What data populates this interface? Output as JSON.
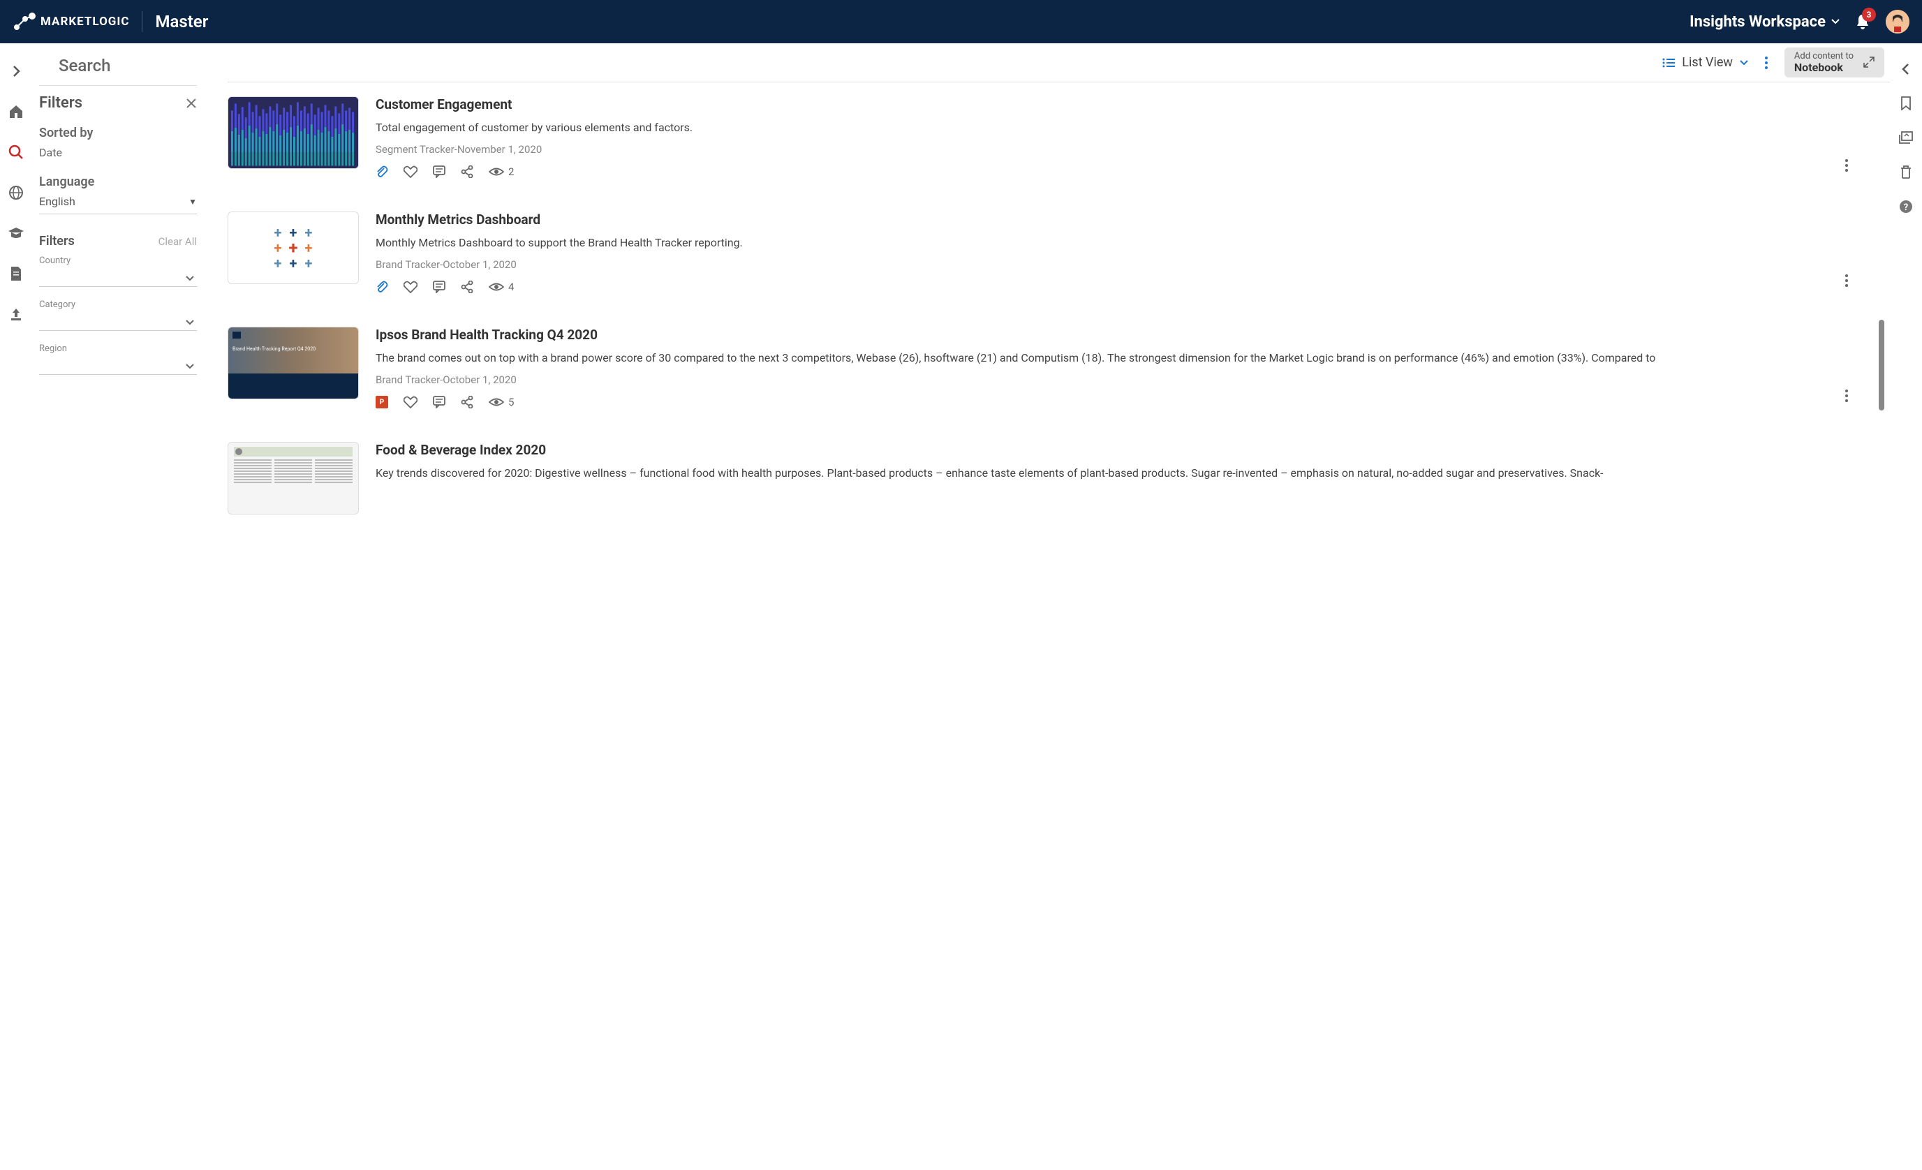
{
  "header": {
    "logo_text": "MARKETLOGIC",
    "app_name": "Master",
    "workspace_label": "Insights Workspace",
    "notification_count": "3"
  },
  "page": {
    "title": "Search"
  },
  "filters": {
    "title": "Filters",
    "sorted_by_label": "Sorted by",
    "sorted_by_value": "Date",
    "language_label": "Language",
    "language_value": "English",
    "filters2_label": "Filters",
    "clear_all": "Clear All",
    "fields": [
      {
        "label": "Country"
      },
      {
        "label": "Category"
      },
      {
        "label": "Region"
      }
    ]
  },
  "toolbar": {
    "view_label": "List View",
    "notebook_line1": "Add content to",
    "notebook_line2": "Notebook"
  },
  "results": [
    {
      "title": "Customer Engagement",
      "desc": "Total engagement of customer by various elements and factors.",
      "meta": "Segment Tracker-November 1, 2020",
      "views": "2",
      "thumb": "chart",
      "file_icon": "link"
    },
    {
      "title": "Monthly Metrics Dashboard",
      "desc": "Monthly Metrics Dashboard to support the Brand Health Tracker reporting.",
      "meta": "Brand Tracker-October 1, 2020",
      "views": "4",
      "thumb": "tableau",
      "file_icon": "link"
    },
    {
      "title": "Ipsos Brand Health Tracking Q4 2020",
      "desc": "The brand comes out on top with a brand power score of 30 compared to the next 3 competitors, Webase (26), hsoftware (21) and Computism (18). The strongest dimension for the Market Logic brand is on performance (46%) and emotion (33%). Compared to",
      "meta": "Brand Tracker-October 1, 2020",
      "views": "5",
      "thumb": "ppt",
      "thumb_label": "Brand Health Tracking Report Q4 2020",
      "file_icon": "ppt"
    },
    {
      "title": "Food & Beverage Index 2020",
      "desc": "Key trends discovered for 2020: Digestive wellness – functional food with health purposes. Plant-based products – enhance taste elements of plant-based products. Sugar re-invented – emphasis on natural, no-added sugar and preservatives. Snack-",
      "meta": "",
      "views": "",
      "thumb": "doc",
      "file_icon": ""
    }
  ]
}
